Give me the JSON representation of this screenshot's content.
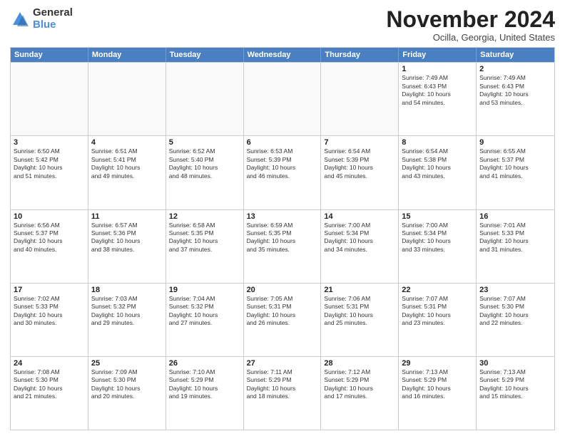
{
  "logo": {
    "general": "General",
    "blue": "Blue"
  },
  "title": "November 2024",
  "location": "Ocilla, Georgia, United States",
  "weekdays": [
    "Sunday",
    "Monday",
    "Tuesday",
    "Wednesday",
    "Thursday",
    "Friday",
    "Saturday"
  ],
  "rows": [
    [
      {
        "day": "",
        "info": ""
      },
      {
        "day": "",
        "info": ""
      },
      {
        "day": "",
        "info": ""
      },
      {
        "day": "",
        "info": ""
      },
      {
        "day": "",
        "info": ""
      },
      {
        "day": "1",
        "info": "Sunrise: 7:49 AM\nSunset: 6:43 PM\nDaylight: 10 hours\nand 54 minutes."
      },
      {
        "day": "2",
        "info": "Sunrise: 7:49 AM\nSunset: 6:43 PM\nDaylight: 10 hours\nand 53 minutes."
      }
    ],
    [
      {
        "day": "3",
        "info": "Sunrise: 6:50 AM\nSunset: 5:42 PM\nDaylight: 10 hours\nand 51 minutes."
      },
      {
        "day": "4",
        "info": "Sunrise: 6:51 AM\nSunset: 5:41 PM\nDaylight: 10 hours\nand 49 minutes."
      },
      {
        "day": "5",
        "info": "Sunrise: 6:52 AM\nSunset: 5:40 PM\nDaylight: 10 hours\nand 48 minutes."
      },
      {
        "day": "6",
        "info": "Sunrise: 6:53 AM\nSunset: 5:39 PM\nDaylight: 10 hours\nand 46 minutes."
      },
      {
        "day": "7",
        "info": "Sunrise: 6:54 AM\nSunset: 5:39 PM\nDaylight: 10 hours\nand 45 minutes."
      },
      {
        "day": "8",
        "info": "Sunrise: 6:54 AM\nSunset: 5:38 PM\nDaylight: 10 hours\nand 43 minutes."
      },
      {
        "day": "9",
        "info": "Sunrise: 6:55 AM\nSunset: 5:37 PM\nDaylight: 10 hours\nand 41 minutes."
      }
    ],
    [
      {
        "day": "10",
        "info": "Sunrise: 6:56 AM\nSunset: 5:37 PM\nDaylight: 10 hours\nand 40 minutes."
      },
      {
        "day": "11",
        "info": "Sunrise: 6:57 AM\nSunset: 5:36 PM\nDaylight: 10 hours\nand 38 minutes."
      },
      {
        "day": "12",
        "info": "Sunrise: 6:58 AM\nSunset: 5:35 PM\nDaylight: 10 hours\nand 37 minutes."
      },
      {
        "day": "13",
        "info": "Sunrise: 6:59 AM\nSunset: 5:35 PM\nDaylight: 10 hours\nand 35 minutes."
      },
      {
        "day": "14",
        "info": "Sunrise: 7:00 AM\nSunset: 5:34 PM\nDaylight: 10 hours\nand 34 minutes."
      },
      {
        "day": "15",
        "info": "Sunrise: 7:00 AM\nSunset: 5:34 PM\nDaylight: 10 hours\nand 33 minutes."
      },
      {
        "day": "16",
        "info": "Sunrise: 7:01 AM\nSunset: 5:33 PM\nDaylight: 10 hours\nand 31 minutes."
      }
    ],
    [
      {
        "day": "17",
        "info": "Sunrise: 7:02 AM\nSunset: 5:33 PM\nDaylight: 10 hours\nand 30 minutes."
      },
      {
        "day": "18",
        "info": "Sunrise: 7:03 AM\nSunset: 5:32 PM\nDaylight: 10 hours\nand 29 minutes."
      },
      {
        "day": "19",
        "info": "Sunrise: 7:04 AM\nSunset: 5:32 PM\nDaylight: 10 hours\nand 27 minutes."
      },
      {
        "day": "20",
        "info": "Sunrise: 7:05 AM\nSunset: 5:31 PM\nDaylight: 10 hours\nand 26 minutes."
      },
      {
        "day": "21",
        "info": "Sunrise: 7:06 AM\nSunset: 5:31 PM\nDaylight: 10 hours\nand 25 minutes."
      },
      {
        "day": "22",
        "info": "Sunrise: 7:07 AM\nSunset: 5:31 PM\nDaylight: 10 hours\nand 23 minutes."
      },
      {
        "day": "23",
        "info": "Sunrise: 7:07 AM\nSunset: 5:30 PM\nDaylight: 10 hours\nand 22 minutes."
      }
    ],
    [
      {
        "day": "24",
        "info": "Sunrise: 7:08 AM\nSunset: 5:30 PM\nDaylight: 10 hours\nand 21 minutes."
      },
      {
        "day": "25",
        "info": "Sunrise: 7:09 AM\nSunset: 5:30 PM\nDaylight: 10 hours\nand 20 minutes."
      },
      {
        "day": "26",
        "info": "Sunrise: 7:10 AM\nSunset: 5:29 PM\nDaylight: 10 hours\nand 19 minutes."
      },
      {
        "day": "27",
        "info": "Sunrise: 7:11 AM\nSunset: 5:29 PM\nDaylight: 10 hours\nand 18 minutes."
      },
      {
        "day": "28",
        "info": "Sunrise: 7:12 AM\nSunset: 5:29 PM\nDaylight: 10 hours\nand 17 minutes."
      },
      {
        "day": "29",
        "info": "Sunrise: 7:13 AM\nSunset: 5:29 PM\nDaylight: 10 hours\nand 16 minutes."
      },
      {
        "day": "30",
        "info": "Sunrise: 7:13 AM\nSunset: 5:29 PM\nDaylight: 10 hours\nand 15 minutes."
      }
    ]
  ]
}
